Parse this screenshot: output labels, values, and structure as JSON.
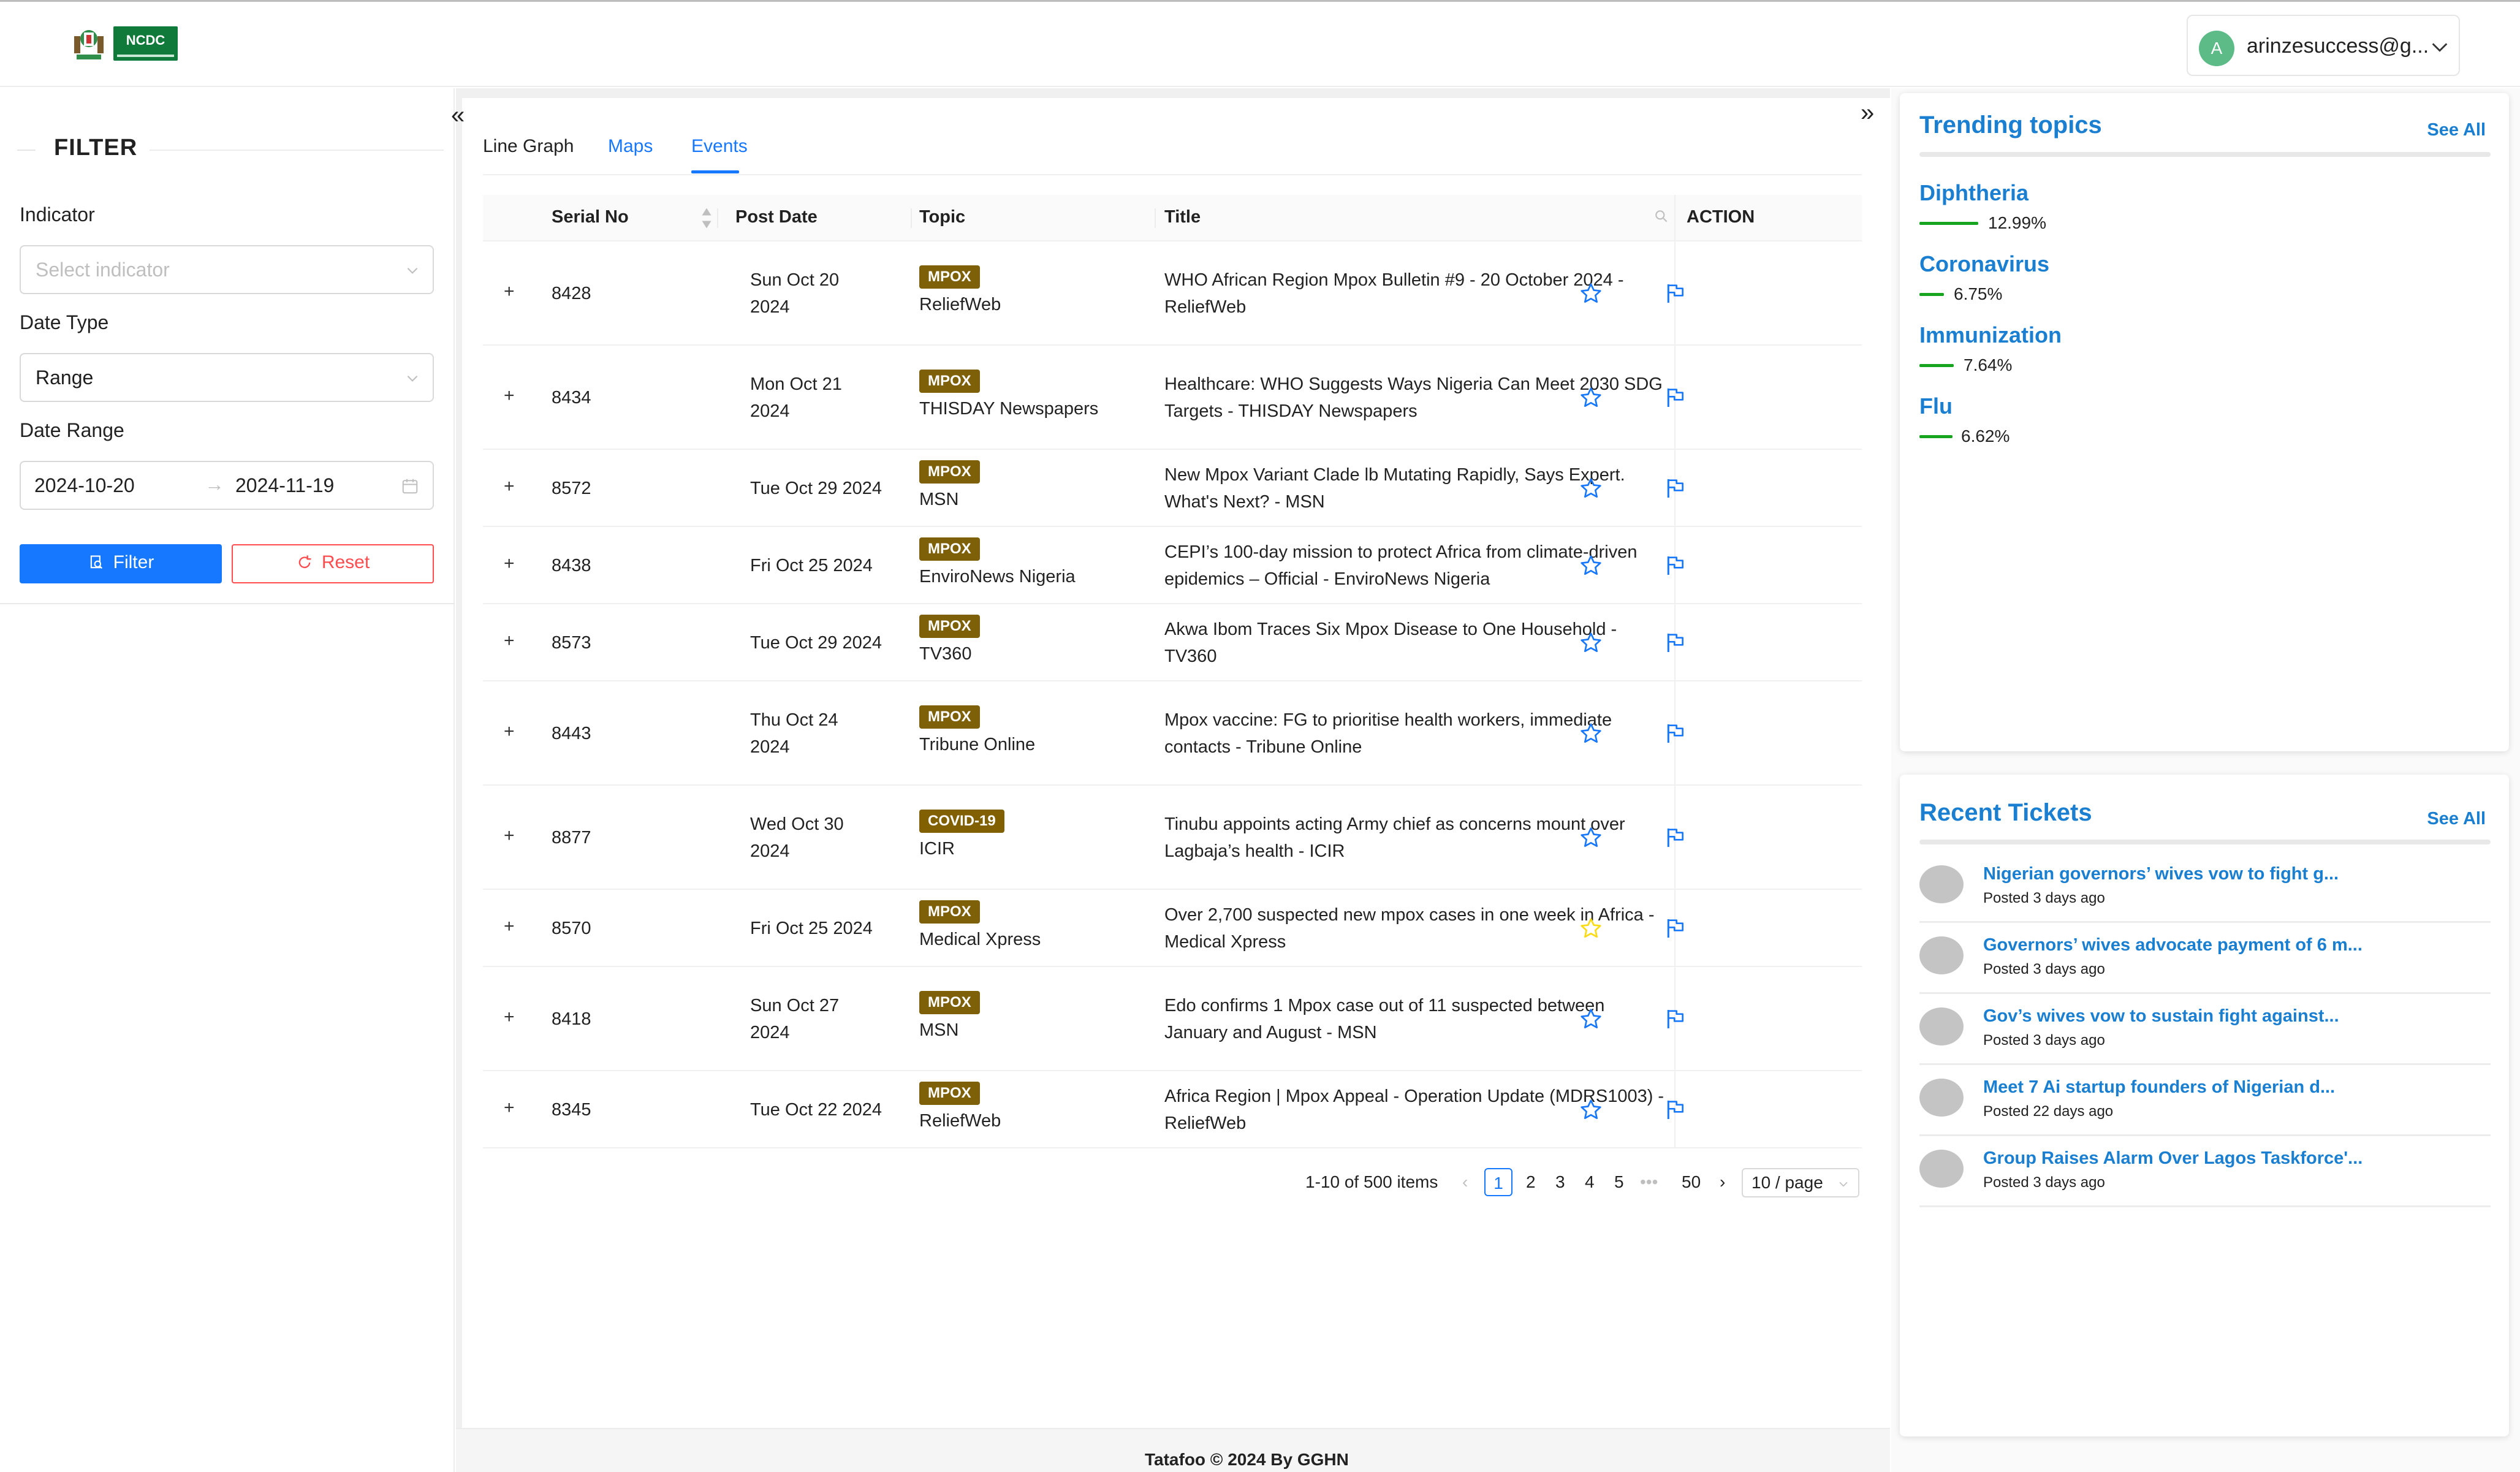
{
  "header": {
    "logo_text": "NCDC",
    "user_initial": "A",
    "user_email": "arinzesuccess@g..."
  },
  "filter": {
    "title": "FILTER",
    "indicator_label": "Indicator",
    "indicator_placeholder": "Select indicator",
    "date_type_label": "Date Type",
    "date_type_value": "Range",
    "date_range_label": "Date Range",
    "date_start": "2024-10-20",
    "date_end": "2024-11-19",
    "range_separator": "→",
    "filter_button": "Filter",
    "reset_button": "Reset"
  },
  "tabs": [
    {
      "label": "Line Graph"
    },
    {
      "label": "Maps"
    },
    {
      "label": "Events"
    }
  ],
  "active_tab": "Events",
  "table": {
    "columns": [
      "Serial No",
      "Post Date",
      "Topic",
      "Title",
      "ACTION"
    ],
    "rows": [
      {
        "serial": "8428",
        "date1": "Sun Oct 20",
        "date2": "2024",
        "tag": "MPOX",
        "source": "ReliefWeb",
        "title1": "WHO African Region Mpox Bulletin #9 - 20 October 2024 -",
        "title2": "ReliefWeb",
        "starred": false
      },
      {
        "serial": "8434",
        "date1": "Mon Oct 21",
        "date2": "2024",
        "tag": "MPOX",
        "source": "THISDAY Newspapers",
        "title1": "Healthcare: WHO Suggests Ways Nigeria Can Meet 2030 SDG",
        "title2": "Targets - THISDAY Newspapers",
        "starred": false
      },
      {
        "serial": "8572",
        "date1": "Tue Oct 29 2024",
        "date2": "",
        "tag": "MPOX",
        "source": "MSN",
        "title1": "New Mpox Variant Clade lb Mutating Rapidly, Says Expert.",
        "title2": "What's Next? - MSN",
        "starred": false
      },
      {
        "serial": "8438",
        "date1": "Fri Oct 25 2024",
        "date2": "",
        "tag": "MPOX",
        "source": "EnviroNews Nigeria",
        "title1": "CEPI’s 100-day mission to protect Africa from climate-driven",
        "title2": "epidemics – Official - EnviroNews Nigeria",
        "starred": false
      },
      {
        "serial": "8573",
        "date1": "Tue Oct 29 2024",
        "date2": "",
        "tag": "MPOX",
        "source": "TV360",
        "title1": "Akwa Ibom Traces Six Mpox Disease to One Household -",
        "title2": "TV360",
        "starred": false
      },
      {
        "serial": "8443",
        "date1": "Thu Oct 24",
        "date2": "2024",
        "tag": "MPOX",
        "source": "Tribune Online",
        "title1": "Mpox vaccine: FG to prioritise health workers, immediate",
        "title2": "contacts - Tribune Online",
        "starred": false
      },
      {
        "serial": "8877",
        "date1": "Wed Oct 30",
        "date2": "2024",
        "tag": "COVID-19",
        "source": "ICIR",
        "title1": "Tinubu appoints acting Army chief as concerns mount over",
        "title2": "Lagbaja’s health - ICIR",
        "starred": false
      },
      {
        "serial": "8570",
        "date1": "Fri Oct 25 2024",
        "date2": "",
        "tag": "MPOX",
        "source": "Medical Xpress",
        "title1": "Over 2,700 suspected new mpox cases in one week in Africa -",
        "title2": "Medical Xpress",
        "starred": true
      },
      {
        "serial": "8418",
        "date1": "Sun Oct 27",
        "date2": "2024",
        "tag": "MPOX",
        "source": "MSN",
        "title1": "Edo confirms 1 Mpox case out of 11 suspected between",
        "title2": "January and August - MSN",
        "starred": false
      },
      {
        "serial": "8345",
        "date1": "Tue Oct 22 2024",
        "date2": "",
        "tag": "MPOX",
        "source": "ReliefWeb",
        "title1": "Africa Region | Mpox Appeal - Operation Update (MDRS1003) -",
        "title2": "ReliefWeb",
        "starred": false
      }
    ]
  },
  "pagination": {
    "summary": "1-10 of 500 items",
    "pages": [
      "1",
      "2",
      "3",
      "4",
      "5",
      "•••",
      "50"
    ],
    "current": "1",
    "page_size": "10 / page"
  },
  "footer": "Tatafoo © 2024  By GGHN",
  "trending": {
    "title": "Trending topics",
    "see_all": "See All",
    "items": [
      {
        "name": "Diphtheria",
        "pct": "12.99%"
      },
      {
        "name": "Coronavirus",
        "pct": "6.75%"
      },
      {
        "name": "Immunization",
        "pct": "7.64%"
      },
      {
        "name": "Flu",
        "pct": "6.62%"
      }
    ]
  },
  "tickets": {
    "title": "Recent Tickets",
    "see_all": "See All",
    "items": [
      {
        "title": "Nigerian governors’ wives vow to fight g...",
        "meta": "Posted 3 days ago"
      },
      {
        "title": "Governors’ wives advocate payment of 6 m...",
        "meta": "Posted 3 days ago"
      },
      {
        "title": "Gov’s wives vow to sustain fight against...",
        "meta": "Posted 3 days ago"
      },
      {
        "title": "Meet 7 Ai startup founders of Nigerian d...",
        "meta": "Posted 22 days ago"
      },
      {
        "title": "Group Raises Alarm Over Lagos Taskforce'...",
        "meta": "Posted 3 days ago"
      }
    ]
  },
  "colors": {
    "primary": "#1677ff",
    "link": "#1a7fd0",
    "danger": "#ff4d4f",
    "tag": "#7d6008",
    "trend_bar": "#17a41e",
    "star_active": "#fadb14"
  }
}
